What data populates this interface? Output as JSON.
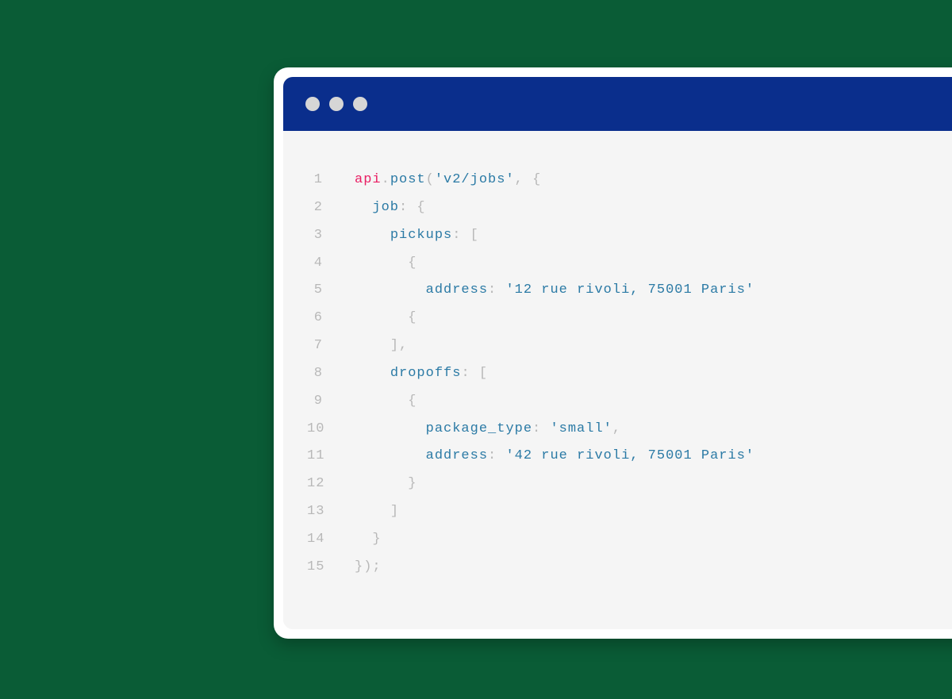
{
  "code": {
    "api_obj": "api",
    "dot": ".",
    "method": "post",
    "call_open": "(",
    "endpoint": "'v2/jobs'",
    "comma_space": ", ",
    "obj_open": "{",
    "job_key": "job",
    "colon_space": ": ",
    "pickups_key": "pickups",
    "arr_open": "[",
    "address_key": "address",
    "pickup_address": "'12 rue rivoli, 75001 Paris'",
    "arr_close": "]",
    "comma": ",",
    "dropoffs_key": "dropoffs",
    "package_type_key": "package_type",
    "package_type_val": "'small'",
    "dropoff_address": "'42 rue rivoli, 75001 Paris'",
    "obj_close": "}",
    "call_close": ")",
    "semi": ";"
  },
  "gutter": {
    "l1": "1",
    "l2": "2",
    "l3": "3",
    "l4": "4",
    "l5": "5",
    "l6": "6",
    "l7": "7",
    "l8": "8",
    "l9": "9",
    "l10": "10",
    "l11": "11",
    "l12": "12",
    "l13": "13",
    "l14": "14",
    "l15": "15"
  }
}
